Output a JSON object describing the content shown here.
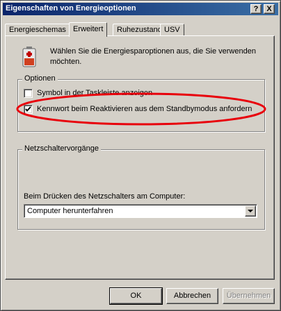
{
  "window": {
    "title": "Eigenschaften von Energieoptionen",
    "help_button": "?",
    "close_button": "X"
  },
  "tabs": [
    {
      "label": "Energieschemas",
      "active": false
    },
    {
      "label": "Erweitert",
      "active": true
    },
    {
      "label": "Ruhezustand",
      "active": false
    },
    {
      "label": "USV",
      "active": false
    }
  ],
  "intro": {
    "icon": "battery-icon",
    "text": "Wählen Sie die Energiesparoptionen aus, die Sie verwenden möchten."
  },
  "options_group": {
    "legend": "Optionen",
    "tray_icon": {
      "label": "Symbol in der Taskleiste anzeigen",
      "checked": false
    },
    "password_on_resume": {
      "label": "Kennwort beim Reaktivieren aus dem Standbymodus anfordern",
      "checked": true
    }
  },
  "power_button_group": {
    "legend": "Netzschaltervorgänge",
    "label": "Beim Drücken des Netzschalters am Computer:",
    "selected": "Computer herunterfahren"
  },
  "buttons": {
    "ok": "OK",
    "cancel": "Abbrechen",
    "apply": "Übernehmen"
  },
  "colors": {
    "title_gradient_start": "#0a246a",
    "title_gradient_end": "#3a6ea5",
    "face": "#d4d0c8",
    "annotation": "#e8000b"
  }
}
